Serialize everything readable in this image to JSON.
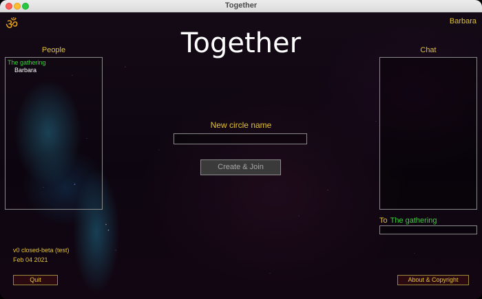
{
  "window": {
    "title": "Together"
  },
  "header": {
    "logo_icon": "om-symbol-icon",
    "logo_glyph": "ॐ",
    "user_name": "Barbara",
    "app_title": "Together"
  },
  "people": {
    "label": "People",
    "group": "The gathering",
    "members": [
      "Barbara"
    ]
  },
  "chat": {
    "label": "Chat",
    "to_label": "To",
    "to_target": "The gathering",
    "input_value": ""
  },
  "new_circle": {
    "label": "New circle name",
    "input_value": "",
    "create_button": "Create & Join"
  },
  "footer": {
    "version": "v0 closed-beta (test)",
    "date": "Feb 04 2021",
    "quit_button": "Quit",
    "about_button": "About & Copyright"
  },
  "colors": {
    "accent_gold": "#e2c23a",
    "group_green": "#39d33a",
    "button_bg": "#2a0a10"
  }
}
